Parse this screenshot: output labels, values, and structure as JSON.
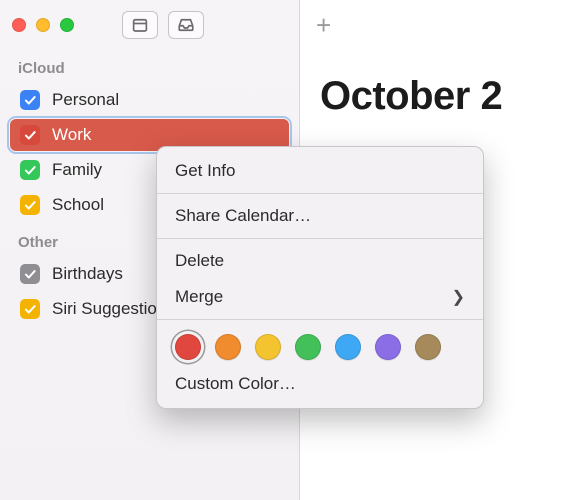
{
  "header": {
    "month_display": "October 2"
  },
  "sections": {
    "icloud": {
      "label": "iCloud",
      "items": [
        {
          "label": "Personal",
          "color": "#3b82f6"
        },
        {
          "label": "Work",
          "color": "#d6493b"
        },
        {
          "label": "Family",
          "color": "#34c759"
        },
        {
          "label": "School",
          "color": "#f5b301"
        }
      ]
    },
    "other": {
      "label": "Other",
      "items": [
        {
          "label": "Birthdays",
          "color": "#8e8e93"
        },
        {
          "label": "Siri Suggestions",
          "color": "#f5b301"
        }
      ]
    }
  },
  "context_menu": {
    "get_info": "Get Info",
    "share": "Share Calendar…",
    "delete": "Delete",
    "merge": "Merge",
    "custom_color": "Custom Color…",
    "colors": [
      "#e0473e",
      "#f08c2e",
      "#f4c430",
      "#43c05a",
      "#3fa8f4",
      "#8b6ee6",
      "#a68a5b"
    ],
    "selected_color_index": 0
  }
}
